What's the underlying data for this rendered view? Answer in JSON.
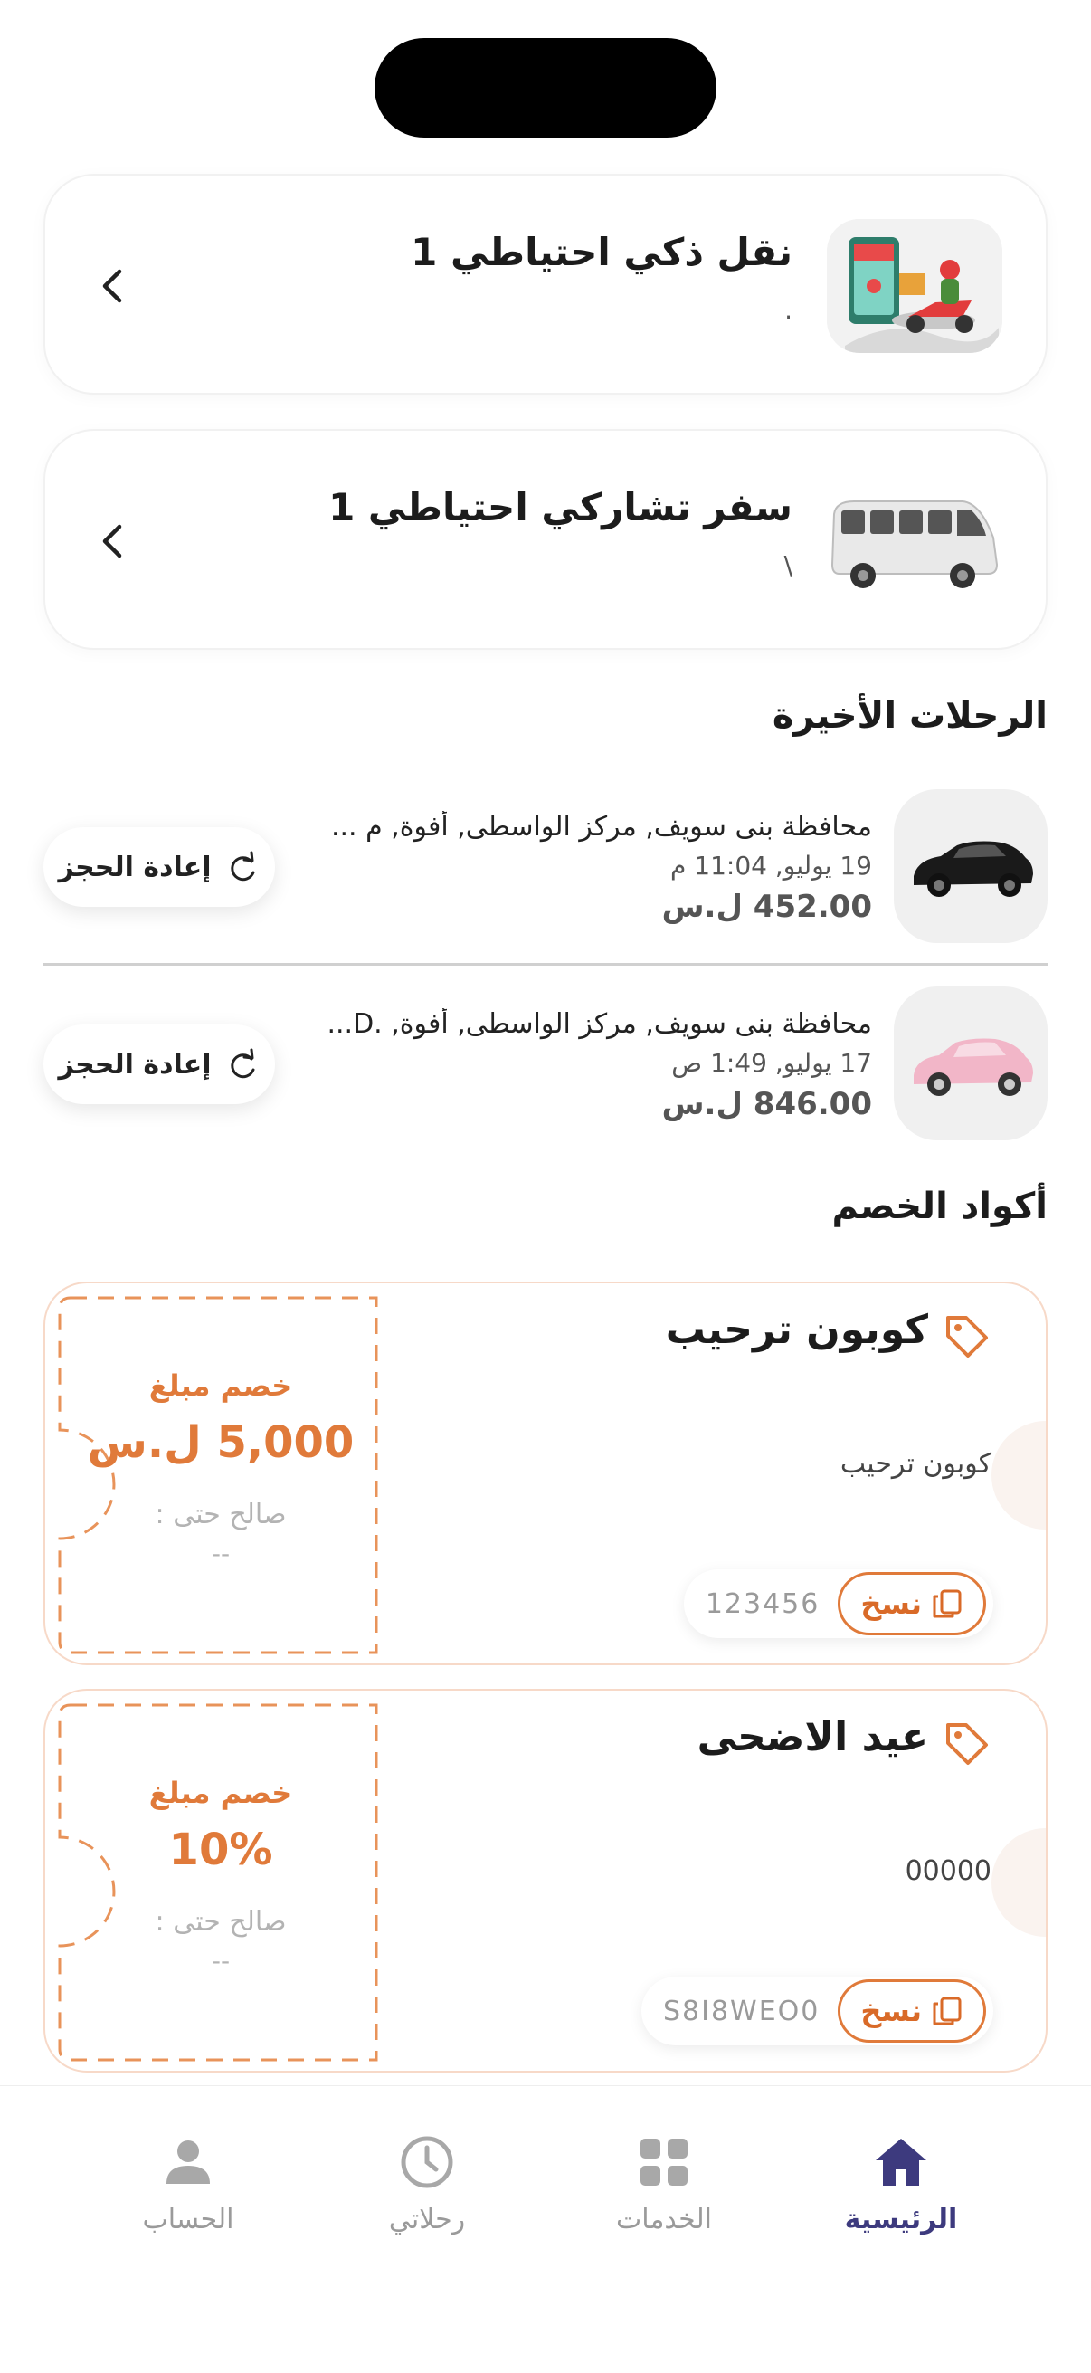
{
  "services": [
    {
      "title": "نقل ذكي احتياطي 1",
      "subtitle": ".",
      "icon": "delivery-scooter-image",
      "chevron": "chevron-left-icon"
    },
    {
      "title": "سفر تشاركي احتياطي 1",
      "subtitle": "\\",
      "icon": "van-image",
      "chevron": "chevron-left-icon"
    }
  ],
  "recent_trips": {
    "title": "الرحلات الأخيرة",
    "items": [
      {
        "address": "محافظة بنى سويف, مركز الواسطى, أفوة, م ...",
        "date": "19 يوليو, 11:04 م",
        "price": "452.00 ل.س",
        "rebook_label": "إعادة الحجز",
        "car_color": "#1a1a1a"
      },
      {
        "address": "محافظة بنى سويف, مركز الواسطى, أفوة, .D...",
        "date": "17 يوليو, 1:49 ص",
        "price": "846.00 ل.س",
        "rebook_label": "إعادة الحجز",
        "car_color": "#f2b6c8"
      }
    ]
  },
  "discounts": {
    "title": "أكواد الخصم",
    "items": [
      {
        "name": "كوبون ترحيب",
        "description": "كوبون ترحيب",
        "amount_label": "خصم مبلغ",
        "amount": "5,000 ل.س",
        "valid_label": "صالح حتى :",
        "valid_value": "--",
        "code": "123456",
        "copy_label": "نسخ"
      },
      {
        "name": "عيد الاضحى",
        "description": "00000",
        "amount_label": "خصم مبلغ",
        "amount": "10%",
        "valid_label": "صالح حتى :",
        "valid_value": "--",
        "code": "S8I8WEO0",
        "copy_label": "نسخ"
      }
    ]
  },
  "bottom_nav": [
    {
      "label": "الحساب",
      "icon": "person-icon",
      "active": false
    },
    {
      "label": "رحلاتي",
      "icon": "clock-icon",
      "active": false
    },
    {
      "label": "الخدمات",
      "icon": "grid-icon",
      "active": false
    },
    {
      "label": "الرئيسية",
      "icon": "home-icon",
      "active": true
    }
  ],
  "colors": {
    "accent": "#e07a3a",
    "nav_active": "#3d3a7e",
    "muted": "#9a9a9a"
  }
}
